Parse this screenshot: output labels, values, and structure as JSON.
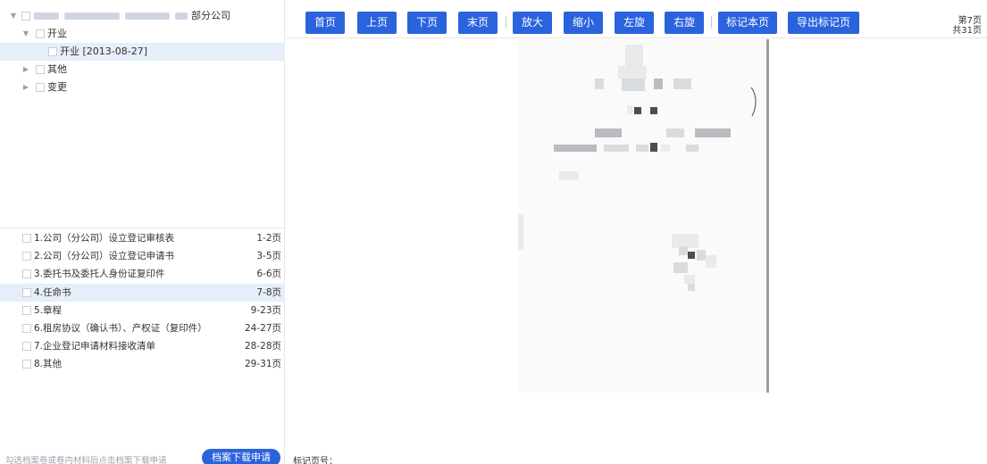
{
  "tree": {
    "root_label_suffix": "部分公司",
    "nodes": [
      {
        "label": "开业",
        "expanded": true
      },
      {
        "label": "开业 [2013-08-27]",
        "selected": true
      },
      {
        "label": "其他",
        "expanded": false
      },
      {
        "label": "变更",
        "expanded": false
      }
    ]
  },
  "materials": [
    {
      "label": "1.公司（分公司）设立登记审核表",
      "pages": "1-2页"
    },
    {
      "label": "2.公司（分公司）设立登记申请书",
      "pages": "3-5页"
    },
    {
      "label": "3.委托书及委托人身份证复印件",
      "pages": "6-6页"
    },
    {
      "label": "4.任命书",
      "pages": "7-8页",
      "selected": true
    },
    {
      "label": "5.章程",
      "pages": "9-23页"
    },
    {
      "label": "6.租房协议（确认书）、产权证（复印件）",
      "pages": "24-27页"
    },
    {
      "label": "7.企业登记申请材料接收清单",
      "pages": "28-28页"
    },
    {
      "label": "8.其他",
      "pages": "29-31页"
    }
  ],
  "footer": {
    "hint": "勾选档案卷或卷内材料后点击档案下载申请",
    "download_button": "档案下载申请"
  },
  "toolbar": {
    "first": "首页",
    "prev": "上页",
    "next": "下页",
    "last": "末页",
    "zoom_in": "放大",
    "zoom_out": "缩小",
    "rotate_left": "左旋",
    "rotate_right": "右旋",
    "mark_page": "标记本页",
    "export_marked": "导出标记页"
  },
  "page_info": {
    "current": "第7页",
    "total": "共31页"
  },
  "mark": {
    "label": "标记页号："
  },
  "colors": {
    "accent": "#2b63dd",
    "selected_row": "#e6eef9"
  }
}
